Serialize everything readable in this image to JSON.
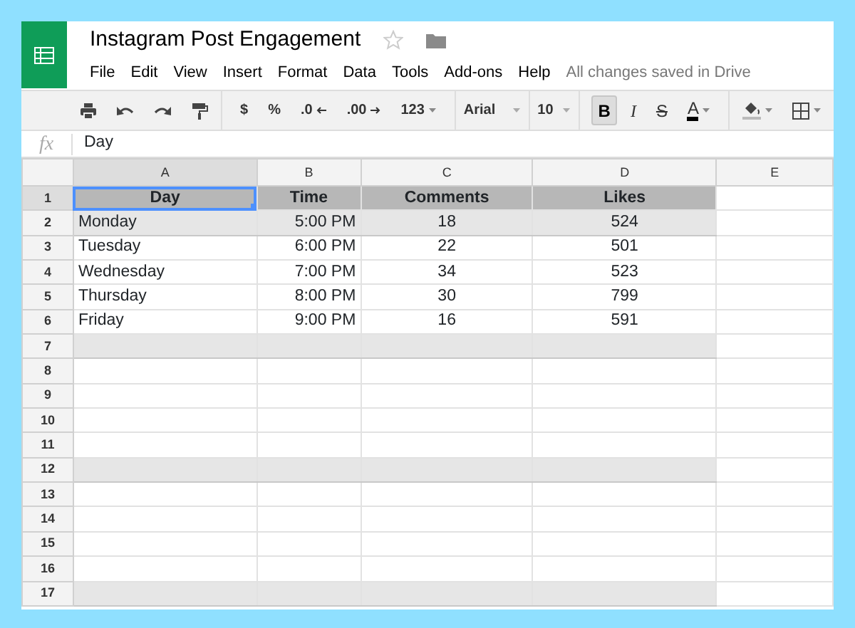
{
  "app": {
    "title": "Instagram Post Engagement",
    "starred": false
  },
  "menu": [
    "File",
    "Edit",
    "View",
    "Insert",
    "Format",
    "Data",
    "Tools",
    "Add-ons",
    "Help"
  ],
  "save_status": "All changes saved in Drive",
  "toolbar": {
    "number_formats": [
      "$",
      "%",
      ".0",
      ".00",
      "123"
    ],
    "font": "Arial",
    "font_size": "10",
    "text_styles": [
      {
        "kind": "bold",
        "label": "B",
        "pressed": true
      },
      {
        "kind": "italic",
        "label": "I",
        "pressed": false
      },
      {
        "kind": "strike",
        "label": "S",
        "pressed": false
      },
      {
        "kind": "color",
        "label": "A",
        "pressed": false
      }
    ]
  },
  "formula_bar": {
    "label": "fx",
    "value": "Day"
  },
  "sheet": {
    "columns": [
      {
        "label": "A",
        "selected": true,
        "kind": "text"
      },
      {
        "label": "B",
        "selected": false,
        "kind": "time"
      },
      {
        "label": "C",
        "selected": false,
        "kind": "number"
      },
      {
        "label": "D",
        "selected": false,
        "kind": "number"
      },
      {
        "label": "E",
        "selected": false
      }
    ],
    "rows": [
      {
        "label": "1",
        "kind": "header",
        "selected": true,
        "cells": [
          "Day",
          "Time",
          "Comments",
          "Likes"
        ]
      },
      {
        "label": "2",
        "kind": "data",
        "selected": false,
        "shaded": true,
        "cells": [
          "Monday",
          "5:00 PM",
          "18",
          "524"
        ]
      },
      {
        "label": "3",
        "kind": "data",
        "selected": false,
        "shaded": false,
        "cells": [
          "Tuesday",
          "6:00 PM",
          "22",
          "501"
        ]
      },
      {
        "label": "4",
        "kind": "data",
        "selected": false,
        "shaded": false,
        "cells": [
          "Wednesday",
          "7:00 PM",
          "34",
          "523"
        ]
      },
      {
        "label": "5",
        "kind": "data",
        "selected": false,
        "shaded": false,
        "cells": [
          "Thursday",
          "8:00 PM",
          "30",
          "799"
        ]
      },
      {
        "label": "6",
        "kind": "data",
        "selected": false,
        "shaded": false,
        "cells": [
          "Friday",
          "9:00 PM",
          "16",
          "591"
        ]
      },
      {
        "label": "7",
        "kind": "data",
        "selected": false,
        "shaded": true,
        "cells": []
      },
      {
        "label": "8",
        "kind": "data",
        "selected": false,
        "shaded": false,
        "cells": []
      },
      {
        "label": "9",
        "kind": "data",
        "selected": false,
        "shaded": false,
        "cells": []
      },
      {
        "label": "10",
        "kind": "data",
        "selected": false,
        "shaded": false,
        "cells": []
      },
      {
        "label": "11",
        "kind": "data",
        "selected": false,
        "shaded": false,
        "cells": []
      },
      {
        "label": "12",
        "kind": "data",
        "selected": false,
        "shaded": true,
        "cells": []
      },
      {
        "label": "13",
        "kind": "data",
        "selected": false,
        "shaded": false,
        "cells": []
      },
      {
        "label": "14",
        "kind": "data",
        "selected": false,
        "shaded": false,
        "cells": []
      },
      {
        "label": "15",
        "kind": "data",
        "selected": false,
        "shaded": false,
        "cells": []
      },
      {
        "label": "16",
        "kind": "data",
        "selected": false,
        "shaded": false,
        "cells": []
      },
      {
        "label": "17",
        "kind": "data",
        "selected": false,
        "shaded": true,
        "cells": []
      }
    ]
  }
}
